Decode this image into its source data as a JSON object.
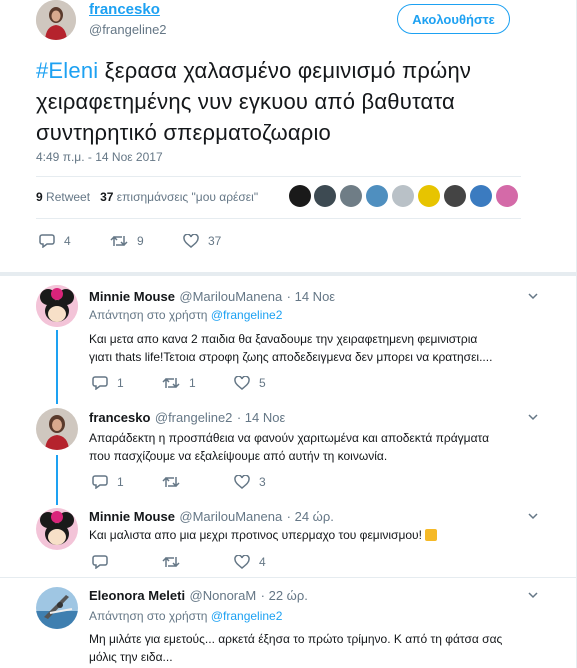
{
  "tweet": {
    "author_name": "francesko",
    "author_handle": "@frangeline2",
    "follow_label": "Ακολουθήστε",
    "hashtag": "#Eleni",
    "text": " ξερασα χαλασμένο φεμινισμό πρώην χειραφετημένης νυν εγκυου από βαθυτατα συντηρητικό σπερματοζωαριο",
    "time": "4:49 π.μ. - 14 Νοε 2017",
    "retweet_count": "9",
    "retweet_label": "Retweet",
    "like_count": "37",
    "like_label": "επισημάνσεις \"μου αρέσει\"",
    "actions": {
      "replies": "4",
      "retweets": "9",
      "likes": "37"
    }
  },
  "replies": [
    {
      "name": "Minnie Mouse",
      "handle": "@MarilouManena",
      "time": "· 14 Νοε",
      "reply_to_prefix": "Απάντηση στο χρήστη ",
      "reply_to_handle": "@frangeline2",
      "line1": "Και μετα απο κανα 2 παιδια θα ξαναδουμε την χειραφετημενη φεμινιστρια",
      "line2": "γιατι thats life!Τετοια στροφη ζωης αποδεδειγμενα δεν μπορει να κρατησει....",
      "replies": "1",
      "retweets": "1",
      "likes": "5"
    },
    {
      "name": "francesko",
      "handle": "@frangeline2",
      "time": "· 14 Νοε",
      "line1": "Απαράδεκτη η προσπάθεια να φανούν χαριτωμένα και αποδεκτά πράγματα",
      "line2": "που πασχίζουμε να εξαλείψουμε από αυτήν τη κοινωνία.",
      "replies": "1",
      "retweets": "",
      "likes": "3"
    },
    {
      "name": "Minnie Mouse",
      "handle": "@MarilouManena",
      "time": "· 24 ώρ.",
      "line1": "Και μαλιστα απο μια μεχρι προτινος υπερμαχο του φεμινισμου!",
      "replies": "",
      "retweets": "",
      "likes": "4"
    },
    {
      "name": "Eleonora Meleti",
      "handle": "@NonoraM",
      "time": "· 22 ώρ.",
      "reply_to_prefix": "Απάντηση στο χρήστη ",
      "reply_to_handle": "@frangeline2",
      "line1": "Μη μιλάτε για εμετούς... αρκετά έξησα το πρώτο τρίμηνο. Κ από τη φάτσα σας",
      "line2": "μόλις την ειδα..."
    }
  ],
  "colors": {
    "accent": "#1da1f2",
    "muted": "#657786",
    "text": "#14171a",
    "divider": "#e6ecf0"
  },
  "icons": [
    "reply-icon",
    "retweet-icon",
    "like-icon",
    "chevron-down-icon"
  ]
}
